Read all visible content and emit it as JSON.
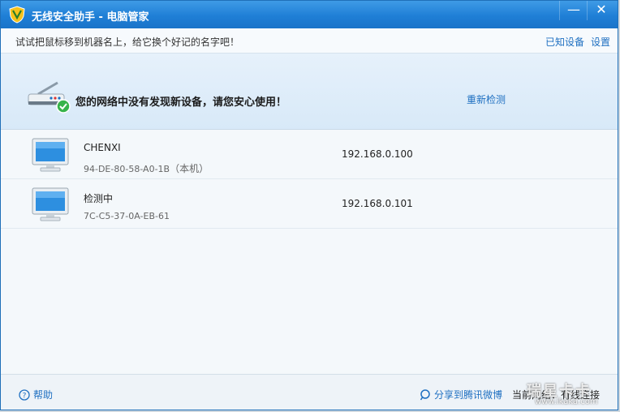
{
  "window": {
    "title": "无线安全助手 - 电脑管家",
    "minimize_glyph": "—",
    "close_glyph": "✕"
  },
  "hintbar": {
    "hint": "试试把鼠标移到机器名上，给它换个好记的名字吧！",
    "known_devices": "已知设备",
    "settings": "设置"
  },
  "banner": {
    "message": "您的网络中没有发现新设备，请您安心使用！",
    "recheck": "重新检测"
  },
  "devices": [
    {
      "name": "CHENXI",
      "mac": "94-DE-80-58-A0-1B",
      "tag": "（本机）",
      "ip": "192.168.0.100"
    },
    {
      "name": "检测中",
      "mac": "7C-C5-37-0A-EB-61",
      "tag": "",
      "ip": "192.168.0.101"
    }
  ],
  "footer": {
    "help": "帮助",
    "share": "分享到腾讯微博",
    "network_status": "当前网络：有线连接",
    "watermark": "瑞星卡卡",
    "watermark_url": "www.ikaka.com"
  },
  "colors": {
    "titlebar": "#1f7fd6",
    "link": "#1e6fc1",
    "ok_badge": "#37b34a"
  },
  "icons": [
    "shield-logo-icon",
    "router-icon",
    "check-badge-icon",
    "monitor-icon",
    "help-icon",
    "weibo-icon"
  ]
}
